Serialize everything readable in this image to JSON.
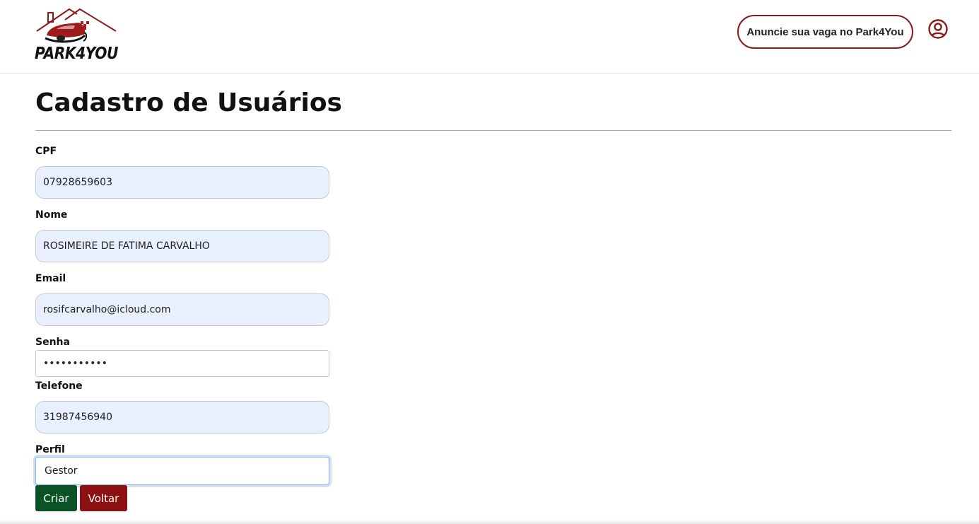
{
  "header": {
    "logo_text": "PARK4YOU",
    "advertise_button": "Anuncie sua vaga no Park4You",
    "user_icon": "user-circle-icon",
    "accent_color": "#8b1a1a"
  },
  "page": {
    "title": "Cadastro de Usuários"
  },
  "form": {
    "cpf": {
      "label": "CPF",
      "value": "07928659603"
    },
    "nome": {
      "label": "Nome",
      "value": "ROSIMEIRE DE FATIMA CARVALHO"
    },
    "email": {
      "label": "Email",
      "value": "rosifcarvalho@icloud.com"
    },
    "senha": {
      "label": "Senha",
      "value": "•••••••••••"
    },
    "telefone": {
      "label": "Telefone",
      "value": "31987456940"
    },
    "perfil": {
      "label": "Perfil",
      "value": "Gestor"
    }
  },
  "actions": {
    "create": "Criar",
    "back": "Voltar",
    "create_color": "#0b5327",
    "back_color": "#8e1111"
  }
}
